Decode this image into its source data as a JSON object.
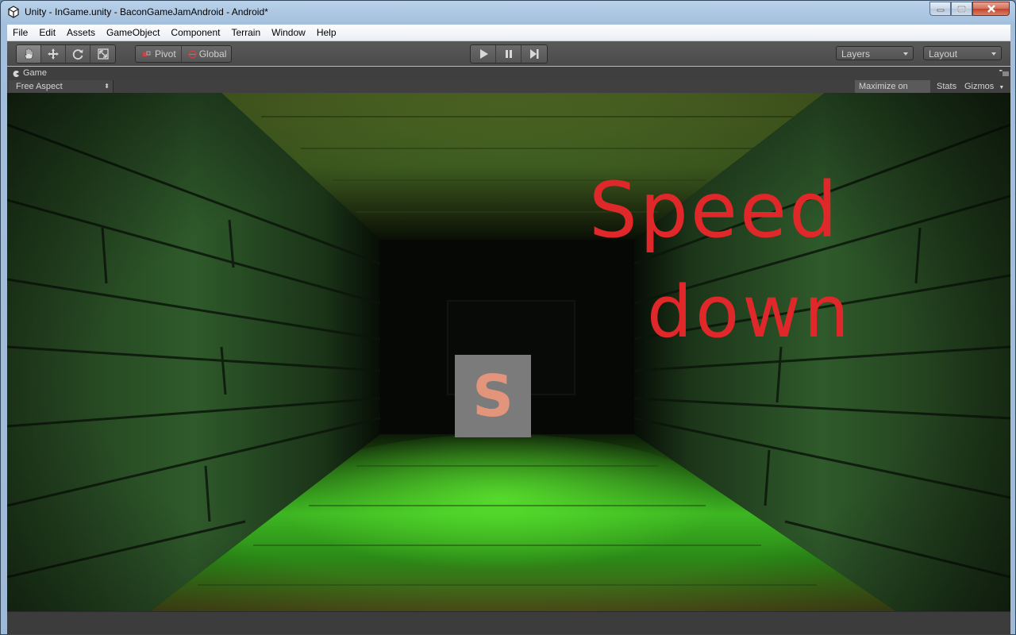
{
  "window": {
    "title": "Unity - InGame.unity - BaconGameJamAndroid - Android*",
    "caption_buttons": [
      "minimize-icon",
      "maximize-icon",
      "close-icon"
    ]
  },
  "menu": {
    "items": [
      "File",
      "Edit",
      "Assets",
      "GameObject",
      "Component",
      "Terrain",
      "Window",
      "Help"
    ]
  },
  "toolbar": {
    "transform_tools": [
      "hand-icon",
      "move-icon",
      "rotate-icon",
      "scale-icon"
    ],
    "pivot_label": "Pivot",
    "global_label": "Global",
    "playback": [
      "play-icon",
      "pause-icon",
      "step-icon"
    ],
    "layers_label": "Layers",
    "layout_label": "Layout"
  },
  "game_view": {
    "tab_label": "Game",
    "aspect_label": "Free Aspect",
    "maximize_label": "Maximize on Play",
    "stats_label": "Stats",
    "gizmos_label": "Gizmos"
  },
  "scene": {
    "overlay_line1": "Speed",
    "overlay_line2": "down",
    "overlay_color": "#e0282a",
    "pickup_letter": "S",
    "pickup_color": "#e3957c"
  },
  "colors": {
    "toolbar": "#4f4f4f",
    "chrome": "#3f3f3f",
    "wall_green": "#2f5a2b",
    "floor_green": "#4fd12f"
  }
}
